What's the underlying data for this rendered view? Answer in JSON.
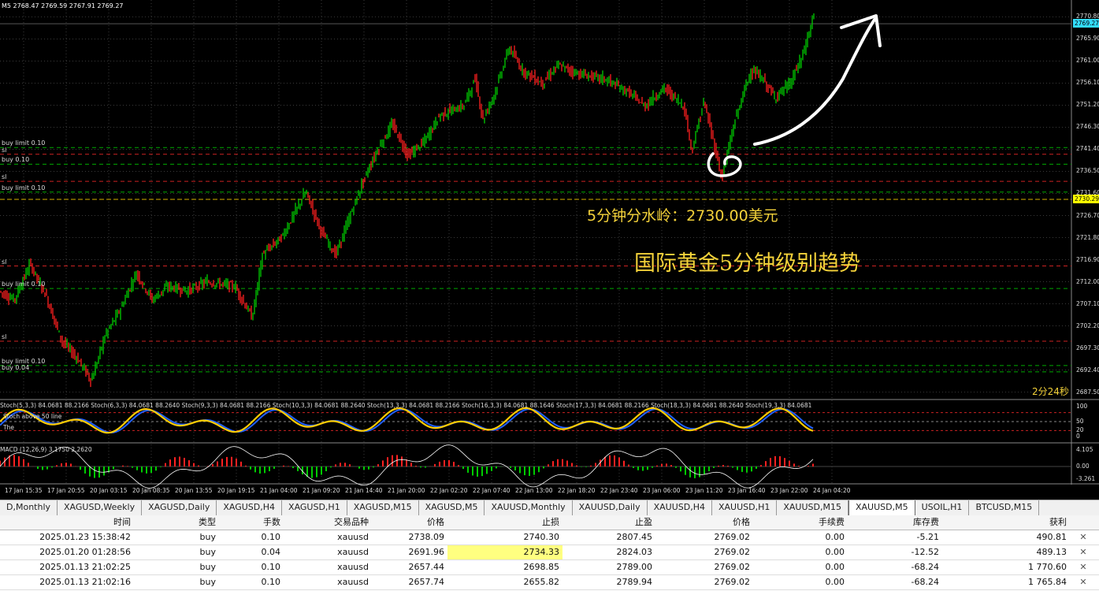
{
  "chart": {
    "ohlc_text": "M5 2768.47 2769.59 2767.91 2769.27",
    "colors": {
      "up": "#00cc00",
      "down": "#ff2020",
      "grid": "#3a3a3a",
      "level_green": "#00aa00",
      "level_red": "#cc2222",
      "level_yellow": "#d4b000",
      "tag_yellow": "#ffff00",
      "tag_cyan": "#33ddff",
      "annotation": "#f4d23a"
    },
    "order_labels": [
      {
        "text": "buy limit 0.10",
        "price": 2741.8
      },
      {
        "text": "sl",
        "price": 2740.3
      },
      {
        "text": "buy 0.10",
        "price": 2738.1
      },
      {
        "text": "sl",
        "price": 2734.3
      },
      {
        "text": "buy limit 0.10",
        "price": 2731.9
      },
      {
        "text": "sl",
        "price": 2715.5
      },
      {
        "text": "buy limit 0.10",
        "price": 2710.5
      },
      {
        "text": "sl",
        "price": 2698.8
      },
      {
        "text": "buy limit 0.10",
        "price": 2693.4
      },
      {
        "text": "buy 0.04",
        "price": 2692.0
      }
    ],
    "price_ticks": [
      "2770.80",
      "2765.90",
      "2761.00",
      "2756.10",
      "2751.20",
      "2746.30",
      "2741.40",
      "2736.50",
      "2731.60",
      "2726.70",
      "2721.80",
      "2716.90",
      "2712.00",
      "2707.10",
      "2702.20",
      "2697.30",
      "2692.40",
      "2687.50"
    ],
    "current_price_tag": "2769.27",
    "breakeven_tag": "2730.29",
    "time_labels": [
      "17 Jan 15:35",
      "17 Jan 20:55",
      "20 Jan 03:15",
      "20 Jan 08:35",
      "20 Jan 13:55",
      "20 Jan 19:15",
      "21 Jan 04:00",
      "21 Jan 09:20",
      "21 Jan 14:40",
      "21 Jan 20:00",
      "22 Jan 02:20",
      "22 Jan 07:40",
      "22 Jan 13:00",
      "22 Jan 18:20",
      "22 Jan 23:40",
      "23 Jan 06:00",
      "23 Jan 11:20",
      "23 Jan 16:40",
      "23 Jan 22:00",
      "24 Jan 04:20"
    ],
    "annotation_1": "5分钟分水岭：2730.00美元",
    "annotation_2": "国际黄金5分钟级别趋势",
    "countdown": "2分24秒",
    "stoch_header": "Stoch(5,3,3) 84.0681 88.2166   Stoch(6,3,3) 84.0681 88.2640   Stoch(9,3,3) 84.0681 88.2166   Stoch(10,3,3) 84.0681 88.2640   Stoch(13,3,3) 84.0681 88.2166   Stoch(16,3,3) 84.0681 88.1646   Stoch(17,3,3) 84.0681 88.2166   Stoch(18,3,3) 84.0681 88.2640   Stoch(19,3,3) 84.0681",
    "stoch_labels": {
      "lbl1": "Stoch above 50 line",
      "lbl2": "The"
    },
    "stoch_ticks": [
      "100",
      "50",
      "20",
      "0"
    ],
    "macd_label": "MACD (12,26,9) 3.1750 2.2620",
    "macd_ticks": [
      "4.105",
      "0.00",
      "-3.261"
    ]
  },
  "tabs": [
    "D,Monthly",
    "XAGUSD,Weekly",
    "XAGUSD,Daily",
    "XAGUSD,H4",
    "XAGUSD,H1",
    "XAGUSD,M15",
    "XAGUSD,M5",
    "XAUUSD,Monthly",
    "XAUUSD,Daily",
    "XAUUSD,H4",
    "XAUUSD,H1",
    "XAUUSD,M15",
    "XAUUSD,M5",
    "USOIL,H1",
    "BTCUSD,M15"
  ],
  "active_tab": "XAUUSD,M5",
  "orders": {
    "headers": [
      "时间",
      "类型",
      "手数",
      "交易品种",
      "价格",
      "止损",
      "止盈",
      "价格",
      "手续费",
      "库存费",
      "获利"
    ],
    "rows": [
      [
        "2025.01.23 15:38:42",
        "buy",
        "0.10",
        "xauusd",
        "2738.09",
        "2740.30",
        "2807.45",
        "2769.02",
        "0.00",
        "-5.21",
        "490.81"
      ],
      [
        "2025.01.20 01:28:56",
        "buy",
        "0.04",
        "xauusd",
        "2691.96",
        "2734.33",
        "2824.03",
        "2769.02",
        "0.00",
        "-12.52",
        "489.13"
      ],
      [
        "2025.01.13 21:02:25",
        "buy",
        "0.10",
        "xauusd",
        "2657.44",
        "2698.85",
        "2789.00",
        "2769.02",
        "0.00",
        "-68.24",
        "1 770.60"
      ],
      [
        "2025.01.13 21:02:16",
        "buy",
        "0.10",
        "xauusd",
        "2657.74",
        "2655.82",
        "2789.94",
        "2769.02",
        "0.00",
        "-68.24",
        "1 765.84"
      ]
    ]
  }
}
